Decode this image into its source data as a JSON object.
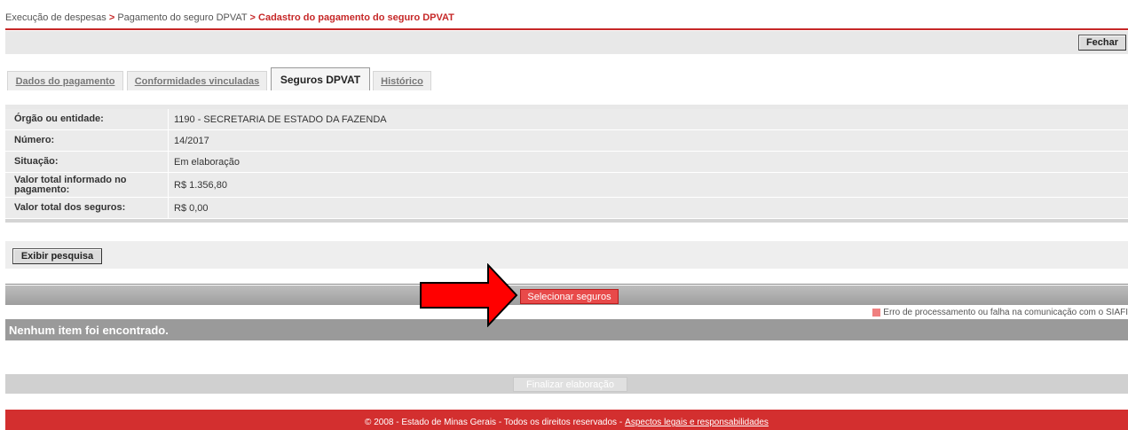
{
  "breadcrumb": {
    "item1": "Execução de despesas",
    "sep1": ">",
    "item2": "Pagamento do seguro DPVAT",
    "sep2": ">",
    "current": "Cadastro do pagamento do seguro DPVAT"
  },
  "toolbar": {
    "close_label": "Fechar"
  },
  "tabs": [
    {
      "label": "Dados do pagamento",
      "active": false
    },
    {
      "label": "Conformidades vinculadas",
      "active": false
    },
    {
      "label": "Seguros DPVAT",
      "active": true
    },
    {
      "label": "Histórico",
      "active": false
    }
  ],
  "info": {
    "rows": [
      {
        "label": "Órgão ou entidade:",
        "value": "1190 - SECRETARIA DE ESTADO DA FAZENDA"
      },
      {
        "label": "Número:",
        "value": "14/2017"
      },
      {
        "label": "Situação:",
        "value": "Em elaboração"
      },
      {
        "label": "Valor total informado no pagamento:",
        "value": "R$ 1.356,80"
      },
      {
        "label": "Valor total dos seguros:",
        "value": "R$ 0,00"
      }
    ]
  },
  "search": {
    "toggle_label": "Exibir pesquisa"
  },
  "selection": {
    "select_label": "Selecionar seguros"
  },
  "legend": {
    "error_text": "Erro de processamento ou falha na comunicação com o SIAFI",
    "error_color": "#f08080"
  },
  "results": {
    "empty_message": "Nenhum item foi encontrado."
  },
  "actions": {
    "finish_label": "Finalizar elaboração"
  },
  "footer": {
    "copyright": "© 2008 - Estado de Minas Gerais - Todos os direitos reservados -",
    "legal_link": "Aspectos legais e responsabilidades"
  },
  "colors": {
    "accent": "#d32f2f",
    "annotation_arrow": "#ff0000"
  },
  "icons": {
    "annotation": "red-arrow-icon"
  }
}
